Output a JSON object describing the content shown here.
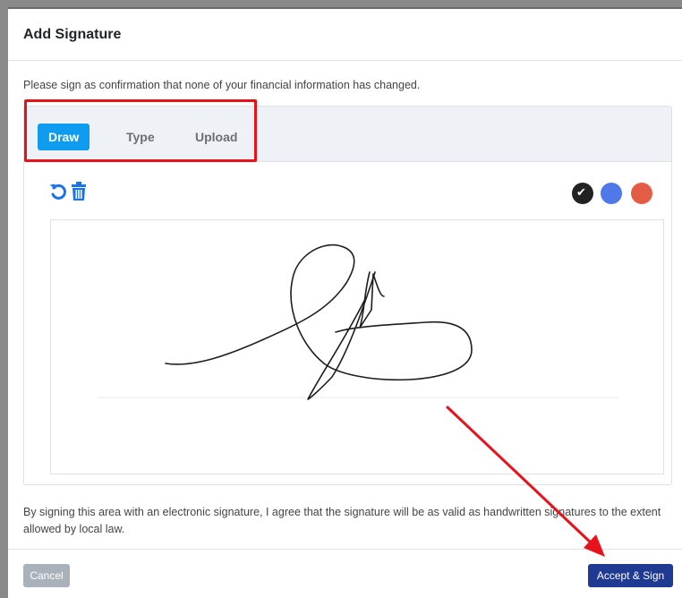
{
  "modal": {
    "title": "Add Signature",
    "intro": "Please sign as confirmation that none of your financial information has changed."
  },
  "tabs": [
    {
      "label": "Draw",
      "active": true
    },
    {
      "label": "Type",
      "active": false
    },
    {
      "label": "Upload",
      "active": false
    }
  ],
  "toolbar": {
    "undo_icon": "undo-icon",
    "clear_icon": "trash-icon"
  },
  "pen_colors": [
    {
      "name": "black",
      "hex": "#222222",
      "selected": true
    },
    {
      "name": "blue",
      "hex": "#4f78e8",
      "selected": false
    },
    {
      "name": "red",
      "hex": "#e35d45",
      "selected": false
    }
  ],
  "disclaimer": "By signing this area with an electronic signature, I agree that the signature will be as valid as handwritten signatures to the extent allowed by local law.",
  "footer": {
    "cancel_label": "Cancel",
    "accept_label": "Accept & Sign"
  },
  "colors": {
    "accent_tab": "#0d9cf0",
    "primary_button": "#1f3a93",
    "highlight": "#e8121a"
  }
}
